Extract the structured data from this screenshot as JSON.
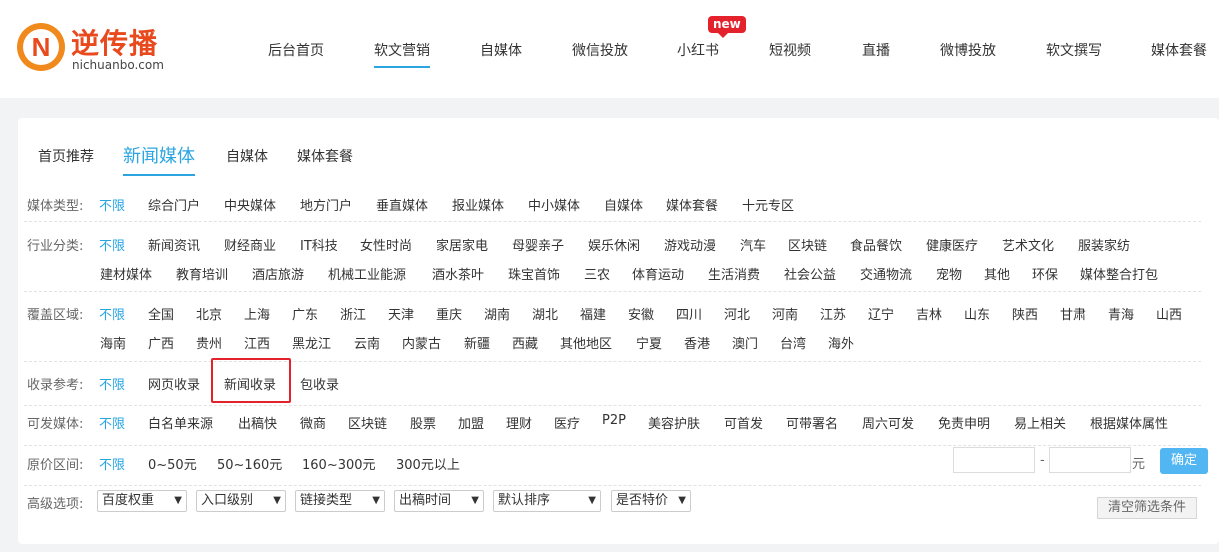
{
  "logo": {
    "cn": "逆传播",
    "en": "nichuanbo.com",
    "letter": "N"
  },
  "nav": {
    "items": [
      "后台首页",
      "软文营销",
      "自媒体",
      "微信投放",
      "小红书",
      "短视频",
      "直播",
      "微博投放",
      "软文撰写",
      "媒体套餐"
    ],
    "active": "软文营销",
    "new_badge": "new"
  },
  "tabs": {
    "items": [
      "首页推荐",
      "新闻媒体",
      "自媒体",
      "媒体套餐"
    ],
    "active": "新闻媒体"
  },
  "filters": {
    "media_type": {
      "label": "媒体类型:",
      "options": [
        "不限",
        "综合门户",
        "中央媒体",
        "地方门户",
        "垂直媒体",
        "报业媒体",
        "中小媒体",
        "自媒体",
        "媒体套餐",
        "十元专区"
      ]
    },
    "industry": {
      "label": "行业分类:",
      "row1": [
        "不限",
        "新闻资讯",
        "财经商业",
        "IT科技",
        "女性时尚",
        "家居家电",
        "母婴亲子",
        "娱乐休闲",
        "游戏动漫",
        "汽车",
        "区块链",
        "食品餐饮",
        "健康医疗",
        "艺术文化",
        "服装家纺"
      ],
      "row2": [
        "建材媒体",
        "教育培训",
        "酒店旅游",
        "机械工业能源",
        "酒水茶叶",
        "珠宝首饰",
        "三农",
        "体育运动",
        "生活消费",
        "社会公益",
        "交通物流",
        "宠物",
        "其他",
        "环保",
        "媒体整合打包"
      ]
    },
    "region": {
      "label": "覆盖区域:",
      "row1": [
        "不限",
        "全国",
        "北京",
        "上海",
        "广东",
        "浙江",
        "天津",
        "重庆",
        "湖南",
        "湖北",
        "福建",
        "安徽",
        "四川",
        "河北",
        "河南",
        "江苏",
        "辽宁",
        "吉林",
        "山东",
        "陕西",
        "甘肃",
        "青海",
        "山西"
      ],
      "row2": [
        "海南",
        "广西",
        "贵州",
        "江西",
        "黑龙江",
        "云南",
        "内蒙古",
        "新疆",
        "西藏",
        "其他地区",
        "宁夏",
        "香港",
        "澳门",
        "台湾",
        "海外"
      ]
    },
    "inclusion": {
      "label": "收录参考:",
      "options": [
        "不限",
        "网页收录",
        "新闻收录",
        "包收录"
      ],
      "highlighted": "新闻收录"
    },
    "publishable": {
      "label": "可发媒体:",
      "options": [
        "不限",
        "白名单来源",
        "出稿快",
        "微商",
        "区块链",
        "股票",
        "加盟",
        "理财",
        "医疗",
        "P2P",
        "美容护肤",
        "可首发",
        "可带署名",
        "周六可发",
        "免责申明",
        "易上相关",
        "根据媒体属性"
      ]
    },
    "price": {
      "label": "原价区间:",
      "options": [
        "不限",
        "0~50元",
        "50~160元",
        "160~300元",
        "300元以上"
      ],
      "dash": "-",
      "unit": "元",
      "confirm": "确定",
      "min_value": "",
      "max_value": ""
    },
    "advanced": {
      "label": "高级选项:",
      "selects": [
        "百度权重",
        "入口级别",
        "链接类型",
        "出稿时间",
        "默认排序",
        "是否特价"
      ],
      "clear": "清空筛选条件"
    }
  },
  "colors": {
    "accent": "#2aa5e0",
    "brand": "#e8491d",
    "highlight": "#e3222c"
  }
}
